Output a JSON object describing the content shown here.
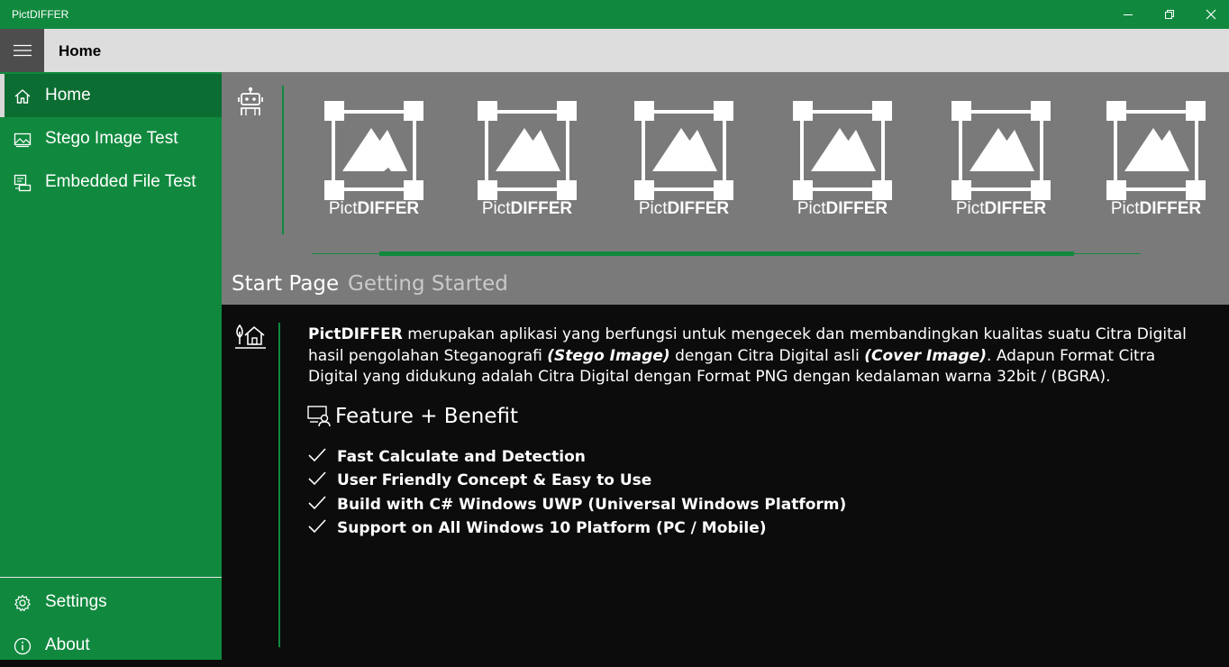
{
  "window": {
    "title": "PictDIFFER",
    "buttons": [
      "minimize-icon",
      "restore-icon",
      "close-icon"
    ]
  },
  "header": {
    "menu_icon": "hamburger-icon",
    "title": "Home"
  },
  "sidebar": {
    "items": [
      {
        "label": "Home",
        "icon": "home-icon",
        "selected": true
      },
      {
        "label": "Stego Image Test",
        "icon": "image-icon"
      },
      {
        "label": "Embedded File Test",
        "icon": "embedded-file-icon"
      }
    ],
    "footer_items": [
      {
        "label": "Settings",
        "icon": "gear-icon"
      },
      {
        "label": "About",
        "icon": "info-icon"
      }
    ]
  },
  "banner": {
    "logos": [
      {
        "pict": "Pict",
        "differ": "DIFFER"
      },
      {
        "pict": "Pict",
        "differ": "DIFFER"
      },
      {
        "pict": "Pict",
        "differ": "DIFFER"
      },
      {
        "pict": "Pict",
        "differ": "DIFFER"
      },
      {
        "pict": "Pict",
        "differ": "DIFFER"
      },
      {
        "pict": "Pict",
        "differ": "DIFFER"
      }
    ]
  },
  "pivot": {
    "tabs": [
      {
        "label": "Start Page",
        "selected": true
      },
      {
        "label": "Getting Started"
      }
    ]
  },
  "content": {
    "intro": {
      "app_name": "PictDIFFER",
      "text_1": " merupakan aplikasi yang berfungsi untuk mengecek dan membandingkan kualitas suatu Citra Digital hasil pengolahan Steganografi ",
      "stego": "(Stego Image)",
      "text_2": " dengan Citra Digital asli ",
      "cover": "(Cover Image)",
      "text_3": ". Adapun Format Citra Digital yang didukung adalah Citra Digital dengan Format PNG dengan kedalaman warna 32bit / (BGRA)."
    },
    "feature_title": "Feature + Benefit",
    "features": [
      "Fast Calculate and Detection",
      "User Friendly Concept & Easy to Use",
      "Build with C# Windows UWP (Universal Windows Platform)",
      "Support on All Windows 10 Platform (PC / Mobile)"
    ]
  },
  "colors": {
    "accent": "#10893e",
    "accent_dark": "#0b6d31",
    "banner": "#7a7a7a",
    "content_bg": "#0c0c0c"
  }
}
